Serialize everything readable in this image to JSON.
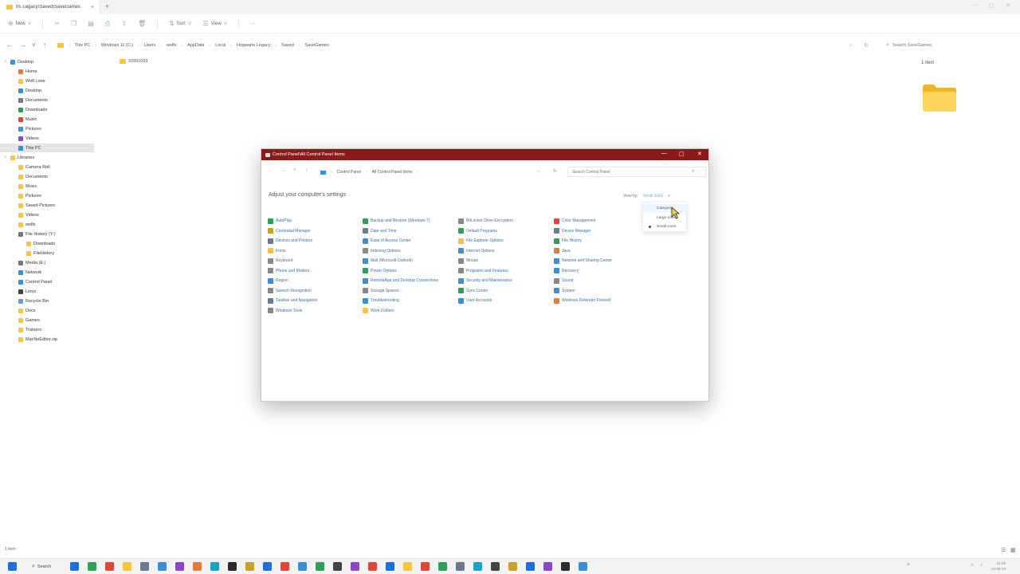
{
  "explorer": {
    "tab_label": "rts Legacy\\Saved\\SaveGames",
    "toolbar": {
      "new": "New",
      "sort": "Sort",
      "view": "View",
      "more": "···"
    },
    "breadcrumbs": [
      "This PC",
      "Windows 11 (C:)",
      "Users",
      "wolfs",
      "AppData",
      "Local",
      "Hogwarts Legacy",
      "Saved",
      "SaveGames"
    ],
    "search_placeholder": "Search SaveGames",
    "nav_items": [
      {
        "label": "Desktop",
        "color": "#3a8fd9",
        "chev": "v"
      },
      {
        "label": "Home",
        "color": "#e07b39",
        "chev": ""
      },
      {
        "label": "Wolf Lone",
        "color": "#f5c542",
        "chev": ""
      },
      {
        "label": "Desktop",
        "color": "#3a8fd9",
        "chev": ""
      },
      {
        "label": "Documents",
        "color": "#6b7a8f",
        "chev": ""
      },
      {
        "label": "Downloads",
        "color": "#2e9e5b",
        "chev": ""
      },
      {
        "label": "Music",
        "color": "#e0463a",
        "chev": ""
      },
      {
        "label": "Pictures",
        "color": "#3a8fd9",
        "chev": ""
      },
      {
        "label": "Videos",
        "color": "#8a46c7",
        "chev": ""
      },
      {
        "label": "This PC",
        "color": "#3a8fd9",
        "chev": "",
        "selected": true
      },
      {
        "label": "Libraries",
        "color": "#f5c542",
        "chev": "v"
      },
      {
        "label": "Camera Roll",
        "color": "#f5c542",
        "chev": ""
      },
      {
        "label": "Documents",
        "color": "#f5c542",
        "chev": ""
      },
      {
        "label": "Music",
        "color": "#f5c542",
        "chev": ""
      },
      {
        "label": "Pictures",
        "color": "#f5c542",
        "chev": ""
      },
      {
        "label": "Saved Pictures",
        "color": "#f5c542",
        "chev": ""
      },
      {
        "label": "Videos",
        "color": "#f5c542",
        "chev": ""
      },
      {
        "label": "wolfs",
        "color": "#f5c542",
        "chev": ""
      },
      {
        "label": "File History (Y:)",
        "color": "#777777",
        "chev": ">"
      },
      {
        "label": "Downloads",
        "color": "#f5c542",
        "chev": ""
      },
      {
        "label": "FileHistory",
        "color": "#f5c542",
        "chev": ""
      },
      {
        "label": "Media (E:)",
        "color": "#777777",
        "chev": ">"
      },
      {
        "label": "Network",
        "color": "#3a8fd9",
        "chev": ">"
      },
      {
        "label": "Control Panel",
        "color": "#3a8fd9",
        "chev": ">"
      },
      {
        "label": "Linux",
        "color": "#444444",
        "chev": ">"
      },
      {
        "label": "Recycle Bin",
        "color": "#6b9bd1",
        "chev": ""
      },
      {
        "label": "Docs",
        "color": "#f5c542",
        "chev": ""
      },
      {
        "label": "Games",
        "color": "#f5c542",
        "chev": ""
      },
      {
        "label": "Trainers",
        "color": "#f5c542",
        "chev": ""
      },
      {
        "label": "MacNeEditor.zip",
        "color": "#f5c542",
        "chev": ""
      }
    ],
    "folder_name": "32891093",
    "details_count": "1 item",
    "status_count": "1 item"
  },
  "control_panel": {
    "title": "Control Panel\\All Control Panel Items",
    "breadcrumbs": [
      "Control Panel",
      "All Control Panel Items"
    ],
    "search_placeholder": "Search Control Panel",
    "heading": "Adjust your computer's settings",
    "view_by_label": "View by:",
    "view_by_value": "Small icons",
    "dropdown": [
      "Category",
      "Large icons",
      "Small icons"
    ],
    "columns": [
      [
        {
          "label": "AutoPlay",
          "color": "#2e9e5b"
        },
        {
          "label": "Credential Manager",
          "color": "#c9a227"
        },
        {
          "label": "Devices and Printers",
          "color": "#6b7a8f"
        },
        {
          "label": "Fonts",
          "color": "#f5c542"
        },
        {
          "label": "Keyboard",
          "color": "#888888"
        },
        {
          "label": "Phone and Modem",
          "color": "#888888"
        },
        {
          "label": "Region",
          "color": "#3a8fd9"
        },
        {
          "label": "Speech Recognition",
          "color": "#888888"
        },
        {
          "label": "Taskbar and Navigation",
          "color": "#6b7a8f"
        },
        {
          "label": "Windows Tools",
          "color": "#888888"
        }
      ],
      [
        {
          "label": "Backup and Restore (Windows 7)",
          "color": "#2e9e5b"
        },
        {
          "label": "Date and Time",
          "color": "#6b7a8f"
        },
        {
          "label": "Ease of Access Center",
          "color": "#3a8fd9"
        },
        {
          "label": "Indexing Options",
          "color": "#888888"
        },
        {
          "label": "Mail (Microsoft Outlook)",
          "color": "#3a8fd9"
        },
        {
          "label": "Power Options",
          "color": "#2e9e5b"
        },
        {
          "label": "RemoteApp and Desktop Connections",
          "color": "#3a8fd9"
        },
        {
          "label": "Storage Spaces",
          "color": "#888888"
        },
        {
          "label": "Troubleshooting",
          "color": "#3a8fd9"
        },
        {
          "label": "Work Folders",
          "color": "#f5c542"
        }
      ],
      [
        {
          "label": "BitLocker Drive Encryption",
          "color": "#888888"
        },
        {
          "label": "Default Programs",
          "color": "#2e9e5b"
        },
        {
          "label": "File Explorer Options",
          "color": "#f5c542"
        },
        {
          "label": "Internet Options",
          "color": "#3a8fd9"
        },
        {
          "label": "Mouse",
          "color": "#888888"
        },
        {
          "label": "Programs and Features",
          "color": "#888888"
        },
        {
          "label": "Security and Maintenance",
          "color": "#3a8fd9"
        },
        {
          "label": "Sync Center",
          "color": "#2e9e5b"
        },
        {
          "label": "User Accounts",
          "color": "#3a8fd9"
        }
      ],
      [
        {
          "label": "Color Management",
          "color": "#e0463a"
        },
        {
          "label": "Device Manager",
          "color": "#6b7a8f"
        },
        {
          "label": "File History",
          "color": "#2e9e5b"
        },
        {
          "label": "Java",
          "color": "#e07b39"
        },
        {
          "label": "Network and Sharing Center",
          "color": "#3a8fd9"
        },
        {
          "label": "Recovery",
          "color": "#3a8fd9"
        },
        {
          "label": "Sound",
          "color": "#888888"
        },
        {
          "label": "System",
          "color": "#3a8fd9"
        },
        {
          "label": "Windows Defender Firewall",
          "color": "#e07b39"
        }
      ]
    ]
  },
  "taskbar": {
    "search_label": "Search",
    "app_colors": [
      "#1e6fd9",
      "#2e9e5b",
      "#e0463a",
      "#f5c542",
      "#6b7a8f",
      "#3a8fd9",
      "#8a46c7",
      "#e07b39",
      "#1aa3c7",
      "#2b2b2b",
      "#c9a227",
      "#1e6fd9",
      "#e0463a",
      "#3a8fd9",
      "#2e9e5b",
      "#444444",
      "#8a46c7",
      "#e0463a",
      "#1e6fd9",
      "#f5c542",
      "#e0463a",
      "#2e9e5b",
      "#6b7a8f",
      "#1aa3c7",
      "#444444",
      "#c9a227",
      "#1e6fd9",
      "#8a46c7",
      "#2b2b2b",
      "#3a8fd9"
    ],
    "clock_time": "21:09",
    "clock_date": "24-08-23"
  }
}
